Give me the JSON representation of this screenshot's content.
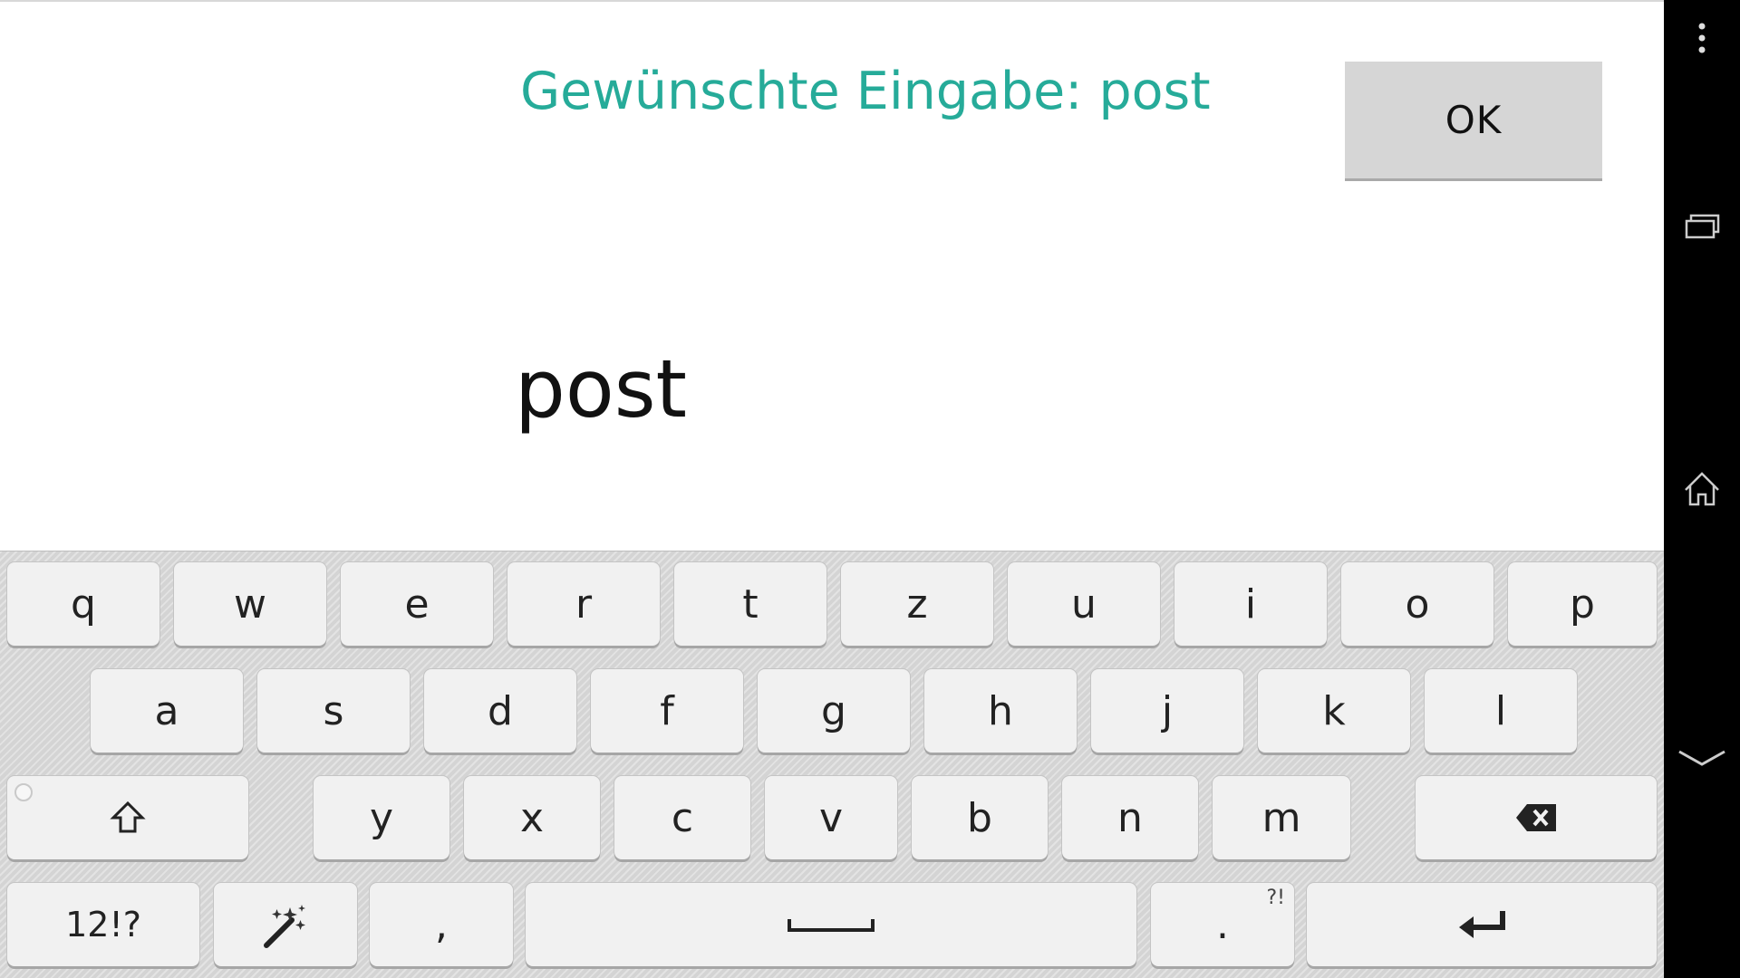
{
  "app": {
    "prompt_text": "Gewünschte Eingabe: post",
    "ok_label": "OK",
    "entered_text": "post",
    "accent_color": "#26ab99"
  },
  "keyboard": {
    "row1": [
      "q",
      "w",
      "e",
      "r",
      "t",
      "z",
      "u",
      "i",
      "o",
      "p"
    ],
    "row2": [
      "a",
      "s",
      "d",
      "f",
      "g",
      "h",
      "j",
      "k",
      "l"
    ],
    "row3": [
      "y",
      "x",
      "c",
      "v",
      "b",
      "n",
      "m"
    ],
    "mode_label": "12!?",
    "comma_label": ",",
    "period_label": ".",
    "period_hint": "?!",
    "icons": {
      "shift": "shift-icon",
      "backspace": "backspace-icon",
      "magic": "magic-wand-icon",
      "space": "space-bar-icon",
      "enter": "enter-icon"
    }
  },
  "navigation_bar": {
    "icons": [
      "overflow-menu-icon",
      "recent-apps-icon",
      "home-icon",
      "hide-keyboard-icon"
    ]
  }
}
